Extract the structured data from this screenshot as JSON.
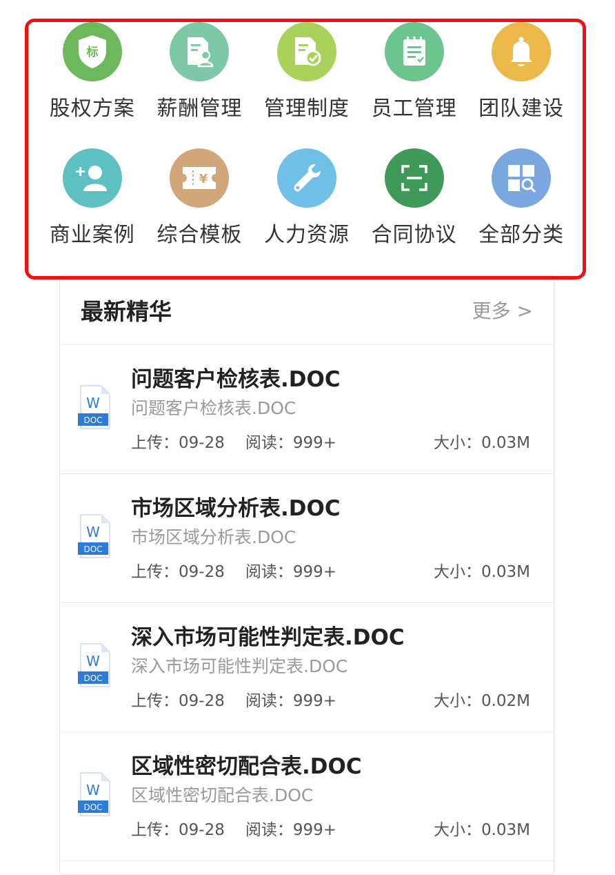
{
  "categories": [
    {
      "label": "股权方案",
      "icon": "shield-badge-icon",
      "color": "#6cb85a",
      "badge": "标"
    },
    {
      "label": "薪酬管理",
      "icon": "document-person-icon",
      "color": "#7dc9a6"
    },
    {
      "label": "管理制度",
      "icon": "document-check-icon",
      "color": "#a9d25a"
    },
    {
      "label": "员工管理",
      "icon": "notepad-icon",
      "color": "#6cc48e"
    },
    {
      "label": "团队建设",
      "icon": "bell-icon",
      "color": "#ecb84a"
    },
    {
      "label": "商业案例",
      "icon": "add-user-icon",
      "color": "#5fc0c4"
    },
    {
      "label": "综合模板",
      "icon": "ticket-icon",
      "color": "#d1a67a",
      "badge": "¥"
    },
    {
      "label": "人力资源",
      "icon": "wrench-icon",
      "color": "#6fbfe6"
    },
    {
      "label": "合同协议",
      "icon": "scan-icon",
      "color": "#3f9a5a"
    },
    {
      "label": "全部分类",
      "icon": "grid-search-icon",
      "color": "#7aa7e0"
    }
  ],
  "section": {
    "title": "最新精华",
    "more": "更多 >"
  },
  "doc_icon": {
    "letter": "W",
    "ext": "DOC",
    "color": "#2f7ad7"
  },
  "docs": [
    {
      "title": "问题客户检核表.DOC",
      "subtitle": "问题客户检核表.DOC",
      "upload": "上传：09-28",
      "reads": "阅读：999+",
      "size": "大小：0.03M"
    },
    {
      "title": "市场区域分析表.DOC",
      "subtitle": "市场区域分析表.DOC",
      "upload": "上传：09-28",
      "reads": "阅读：999+",
      "size": "大小：0.03M"
    },
    {
      "title": "深入市场可能性判定表.DOC",
      "subtitle": "深入市场可能性判定表.DOC",
      "upload": "上传：09-28",
      "reads": "阅读：999+",
      "size": "大小：0.02M"
    },
    {
      "title": "区域性密切配合表.DOC",
      "subtitle": "区域性密切配合表.DOC",
      "upload": "上传：09-28",
      "reads": "阅读：999+",
      "size": "大小：0.03M"
    }
  ]
}
